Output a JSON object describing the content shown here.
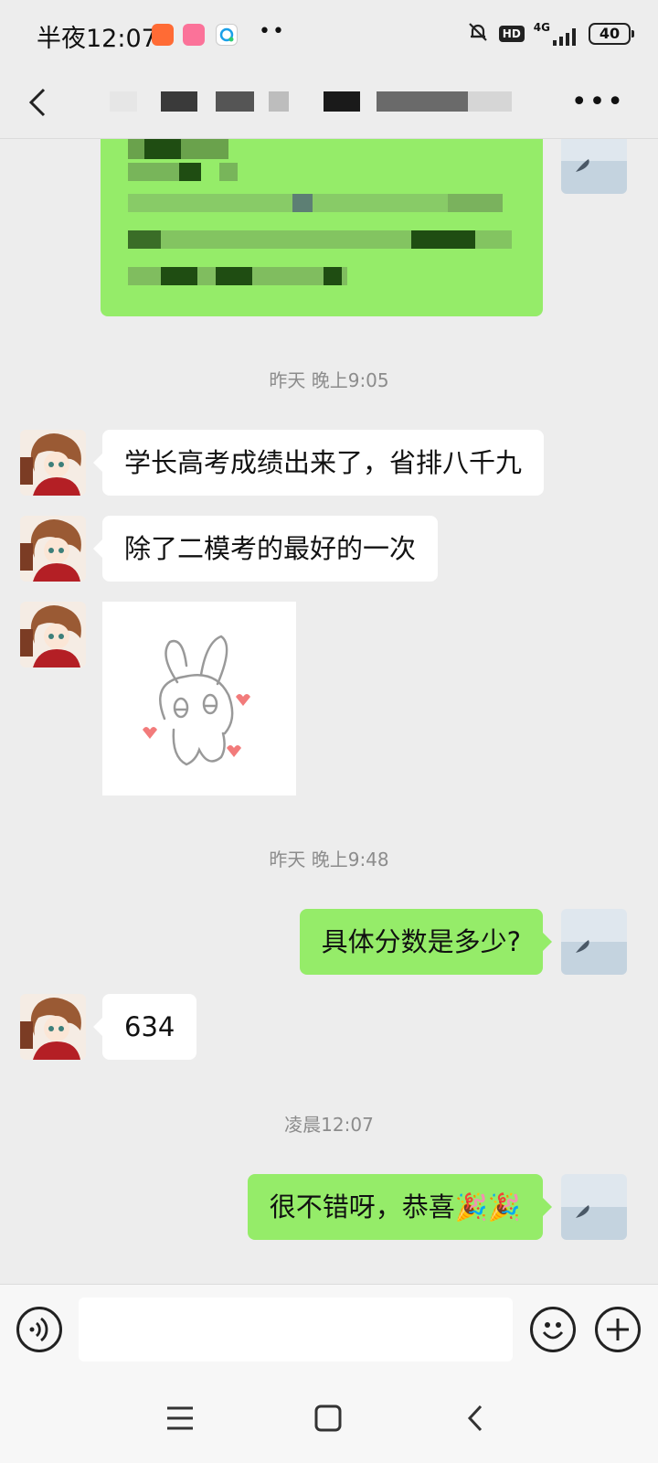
{
  "status_bar": {
    "time": "半夜12:07",
    "network": "4G",
    "hd": "HD",
    "battery": "40",
    "icons": [
      "mi-store-icon",
      "bilibili-icon",
      "chat-app-icon",
      "more-dots-icon",
      "muted-bell-icon",
      "hd-voice-icon",
      "signal-icon",
      "battery-icon"
    ]
  },
  "nav": {
    "back_icon": "chevron-left-icon",
    "title": "[blurred]",
    "more_icon": "more-horizontal-icon"
  },
  "messages": [
    {
      "type": "text-blurred",
      "side": "right"
    },
    {
      "type": "timestamp",
      "text": "昨天 晚上9:05"
    },
    {
      "type": "text",
      "side": "left",
      "text": "学长高考成绩出来了，省排八千九"
    },
    {
      "type": "text",
      "side": "left",
      "text": "除了二模考的最好的一次"
    },
    {
      "type": "sticker",
      "side": "left",
      "sticker": "bunny-sticker"
    },
    {
      "type": "timestamp",
      "text": "昨天 晚上9:48"
    },
    {
      "type": "text",
      "side": "right",
      "text": "具体分数是多少?"
    },
    {
      "type": "text",
      "side": "left",
      "text": "634"
    },
    {
      "type": "timestamp",
      "text": "凌晨12:07"
    },
    {
      "type": "text",
      "side": "right",
      "text": "很不错呀，恭喜🎉🎉"
    }
  ],
  "input_bar": {
    "placeholder": "",
    "voice_icon": "voice-icon",
    "emoji_icon": "emoji-icon",
    "plus_icon": "plus-icon"
  },
  "system_nav": [
    "menu-icon",
    "home-icon",
    "back-icon"
  ],
  "colors": {
    "background": "#ededed",
    "bubble_self": "#95ec69",
    "bubble_other": "#ffffff",
    "timestamp": "#8c8c8c"
  }
}
